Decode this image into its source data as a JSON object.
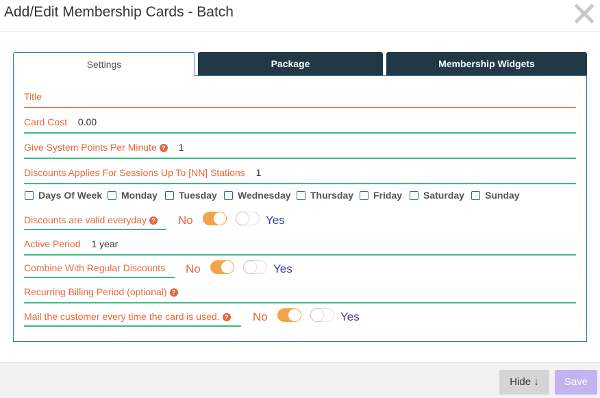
{
  "modal": {
    "title": "Add/Edit Membership Cards - Batch",
    "close_icon": "close-icon"
  },
  "tabs": [
    {
      "label": "Settings",
      "active": true
    },
    {
      "label": "Package",
      "active": false
    },
    {
      "label": "Membership Widgets",
      "active": false
    }
  ],
  "form": {
    "title_label": "Title",
    "title_value": "",
    "card_cost_label": "Card Cost",
    "card_cost_value": "0.00",
    "points_label": "Give System Points Per Minute",
    "points_value": "1",
    "discount_stations_label": "Discounts Applies For Sessions Up To [NN] Stations",
    "discount_stations_value": "1",
    "days": [
      {
        "label": "Days Of Week",
        "checked": false
      },
      {
        "label": "Monday",
        "checked": false
      },
      {
        "label": "Tuesday",
        "checked": false
      },
      {
        "label": "Wednesday",
        "checked": false
      },
      {
        "label": "Thursday",
        "checked": false
      },
      {
        "label": "Friday",
        "checked": false
      },
      {
        "label": "Saturday",
        "checked": false
      },
      {
        "label": "Sunday",
        "checked": false
      }
    ],
    "valid_everyday": {
      "label": "Discounts are valid everyday",
      "no": "No",
      "yes": "Yes",
      "selected": "No"
    },
    "active_period_label": "Active Period",
    "active_period_value": "1 year",
    "combine": {
      "label": "Combine With Regular Discounts",
      "no": "No",
      "yes": "Yes",
      "selected": "No"
    },
    "recurring_label": "Recurring Billing Period (optional)",
    "mail": {
      "label": "Mail the customer every time the card is used.",
      "no": "No",
      "yes": "Yes",
      "selected": "No"
    },
    "help_icon": "question-circle-icon"
  },
  "footer": {
    "hide_label": "Hide ↓",
    "save_label": "Save"
  },
  "colors": {
    "accent_orange": "#e5673a",
    "toggle_on": "#f5a34a",
    "underline_green": "#3fb88a",
    "tab_dark": "#233845",
    "save_button": "#c5b3ef",
    "yes_text": "#3a3a9e"
  }
}
